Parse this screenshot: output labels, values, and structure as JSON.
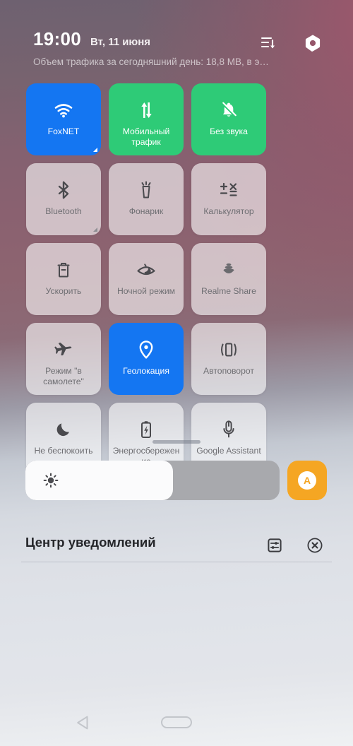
{
  "header": {
    "clock": "19:00",
    "date": "Вт, 11 июня",
    "traffic_text": "Объем трафика за сегодняшний день: 18,8 MB, в э…",
    "edit_order_icon": "sort-lines-down-icon",
    "settings_icon": "settings-hex-icon"
  },
  "tiles": [
    {
      "label": "FoxNET",
      "icon": "wifi-icon",
      "state": "on-blue",
      "corner": true
    },
    {
      "label": "Мобильный трафик",
      "icon": "mobile-data-icon",
      "state": "on-green",
      "corner": false
    },
    {
      "label": "Без звука",
      "icon": "bell-muted-icon",
      "state": "on-green",
      "corner": false
    },
    {
      "label": "Bluetooth",
      "icon": "bluetooth-icon",
      "state": "off",
      "corner": true
    },
    {
      "label": "Фонарик",
      "icon": "flashlight-icon",
      "state": "off",
      "corner": false
    },
    {
      "label": "Калькулятор",
      "icon": "calculator-icon",
      "state": "off",
      "corner": false
    },
    {
      "label": "Ускорить",
      "icon": "trash-clean-icon",
      "state": "off",
      "corner": false
    },
    {
      "label": "Ночной режим",
      "icon": "eye-night-icon",
      "state": "off",
      "corner": false
    },
    {
      "label": "Realme Share",
      "icon": "realme-share-icon",
      "state": "off",
      "corner": false
    },
    {
      "label": "Режим \"в самолете\"",
      "icon": "airplane-icon",
      "state": "off",
      "corner": false
    },
    {
      "label": "Геолокация",
      "icon": "location-pin-icon",
      "state": "on-blue",
      "corner": false
    },
    {
      "label": "Автоповорот",
      "icon": "auto-rotate-icon",
      "state": "off",
      "corner": false
    },
    {
      "label": "Не беспокоить",
      "icon": "moon-icon",
      "state": "off",
      "corner": false
    },
    {
      "label": "Энергосбережение",
      "icon": "battery-saver-icon",
      "state": "off",
      "corner": false
    },
    {
      "label": "Google Assistant",
      "icon": "microphone-icon",
      "state": "off",
      "corner": false
    }
  ],
  "brightness": {
    "icon": "brightness-sun-icon",
    "level_percent": 58,
    "auto_label": "A",
    "auto_color": "#f5a623"
  },
  "notification_center": {
    "title": "Центр уведомлений",
    "settings_icon": "notification-settings-icon",
    "clear_all_icon": "clear-all-circle-icon"
  },
  "nav_bar": {
    "back_icon": "back-triangle-icon",
    "home_icon": "home-pill-icon"
  },
  "colors": {
    "accent_blue": "#1476f2",
    "accent_green": "#2ecb77",
    "auto_orange": "#f5a623"
  }
}
